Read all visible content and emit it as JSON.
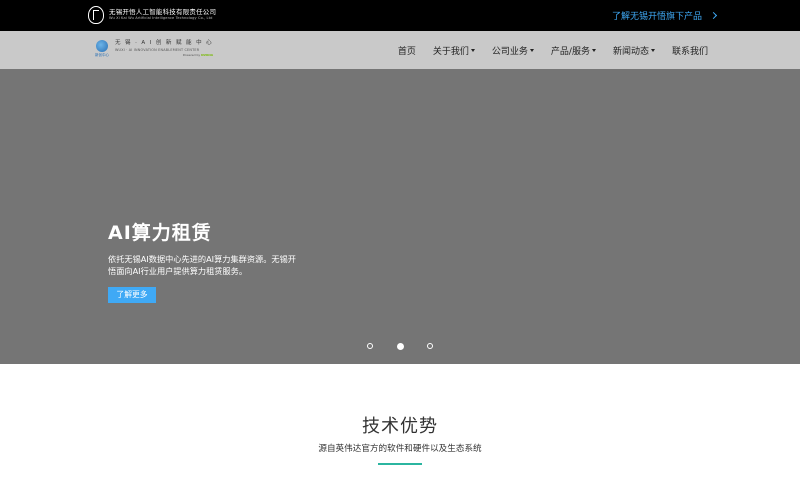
{
  "topbar": {
    "company_cn": "无锡开悟人工智能科技有限责任公司",
    "company_en": "Wu Xi Kai Wu Artificial Intelligence Technology Co., Ltd",
    "link_label": "了解无锡开悟旗下产品"
  },
  "navbar": {
    "logo_cn": "无 锡 · A I 创 新 赋 能 中 心",
    "logo_en": "WUXI · AI INNOVATION ENABLEMENT CENTER",
    "logo_badge_text": "新创中心",
    "logo_powered": "Powered by",
    "logo_powered_brand": "NVIDIA",
    "menu": [
      {
        "label": "首页",
        "has_dropdown": false
      },
      {
        "label": "关于我们",
        "has_dropdown": true
      },
      {
        "label": "公司业务",
        "has_dropdown": true
      },
      {
        "label": "产品/服务",
        "has_dropdown": true
      },
      {
        "label": "新闻动态",
        "has_dropdown": true
      },
      {
        "label": "联系我们",
        "has_dropdown": false
      }
    ]
  },
  "hero": {
    "title": "AI算力租赁",
    "description": "依托无锡AI数据中心先进的AI算力集群资源。无锡开悟面向AI行业用户提供算力租赁服务。",
    "button_label": "了解更多",
    "slide_count": 3,
    "active_slide": 2
  },
  "section": {
    "title": "技术优势",
    "subtitle": "源自英伟达官方的软件和硬件以及生态系统"
  },
  "colors": {
    "accent_blue": "#3fa9f5",
    "accent_teal": "#2bb5a0",
    "hero_bg": "#757575",
    "nav_bg": "#c9c9c9"
  }
}
